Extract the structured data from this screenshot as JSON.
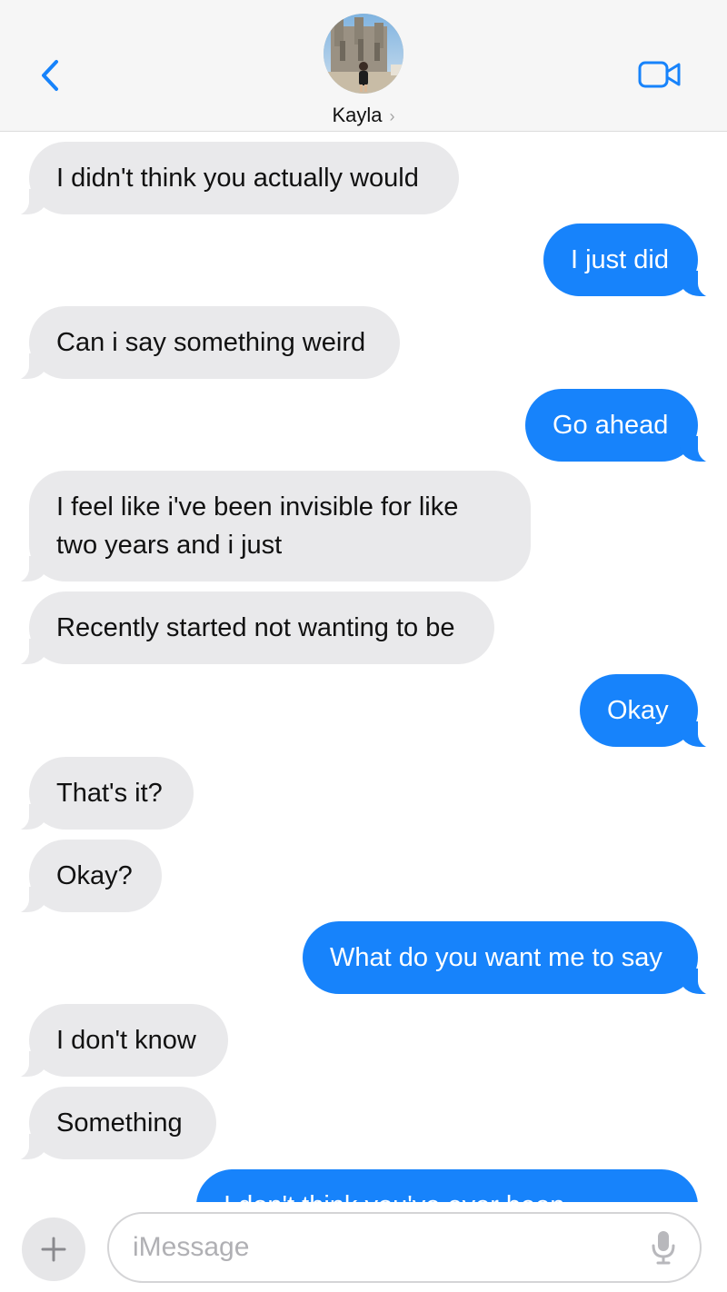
{
  "header": {
    "contact_name": "Kayla",
    "name_chevron": "›",
    "back_icon": "chevron-left-icon",
    "video_icon": "video-camera-icon",
    "accent_color": "#1783fb"
  },
  "messages": [
    {
      "direction": "incoming",
      "text": "I didn't think you actually would"
    },
    {
      "direction": "outgoing",
      "text": "I just did"
    },
    {
      "direction": "incoming",
      "text": "Can i say something weird"
    },
    {
      "direction": "outgoing",
      "text": "Go ahead"
    },
    {
      "direction": "incoming",
      "text": "I feel like i've been invisible for like two years and i just"
    },
    {
      "direction": "incoming",
      "text": "Recently started not wanting to be"
    },
    {
      "direction": "outgoing",
      "text": "Okay"
    },
    {
      "direction": "incoming",
      "text": "That's it?"
    },
    {
      "direction": "incoming",
      "text": "Okay?"
    },
    {
      "direction": "outgoing",
      "text": "What do you want me to say"
    },
    {
      "direction": "incoming",
      "text": "I don't know"
    },
    {
      "direction": "incoming",
      "text": "Something"
    },
    {
      "direction": "outgoing",
      "text": "I don't think you've ever been"
    }
  ],
  "composer": {
    "placeholder": "iMessage",
    "plus_icon": "plus-icon",
    "mic_icon": "microphone-icon"
  }
}
